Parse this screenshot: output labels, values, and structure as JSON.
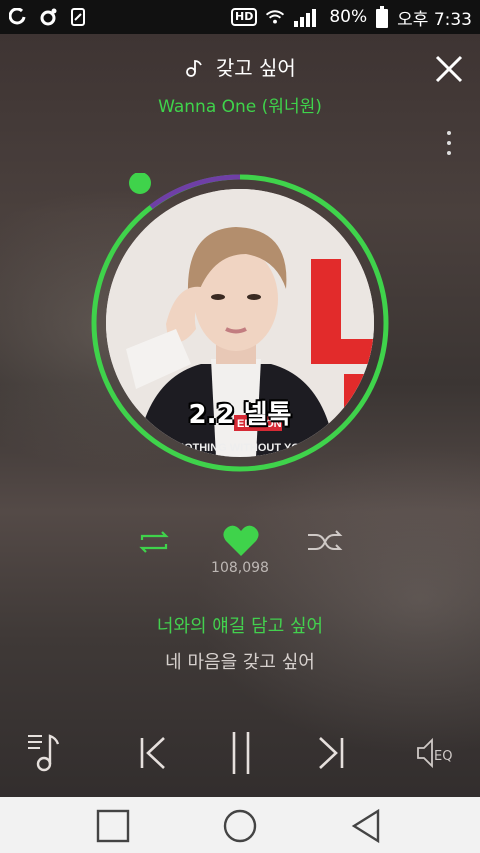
{
  "status_bar": {
    "hd_label": "HD",
    "battery_percent": "80%",
    "time": "오후 7:33",
    "icons": [
      "round-app-icon",
      "notification-dot-icon",
      "device-icon",
      "wifi-icon",
      "signal-icon",
      "battery-icon"
    ]
  },
  "player": {
    "song_title": "갖고 싶어",
    "artist": "Wanna One (워너원)",
    "album_overlay_text": "2.2 넬톡",
    "like_count": "108,098",
    "lyric_current": "너와의 얘길 담고 싶어",
    "lyric_next": "네 마음을 갖고 싶어",
    "progress_fraction": 0.02,
    "eq_label": "EQ"
  },
  "colors": {
    "accent": "#3fd34b",
    "status_bar_bg": "#111111",
    "nav_bar_bg": "#f2f2f2"
  },
  "icons": {
    "title": "music-note-icon",
    "close": "close-icon",
    "more": "more-vertical-icon",
    "repeat": "repeat-icon",
    "like": "heart-icon",
    "shuffle": "shuffle-icon",
    "playlist": "playlist-icon",
    "prev": "previous-icon",
    "pause": "pause-icon",
    "next": "next-icon",
    "eq": "equalizer-icon",
    "nav_recent": "recent-apps-icon",
    "nav_home": "home-icon",
    "nav_back": "back-icon"
  }
}
